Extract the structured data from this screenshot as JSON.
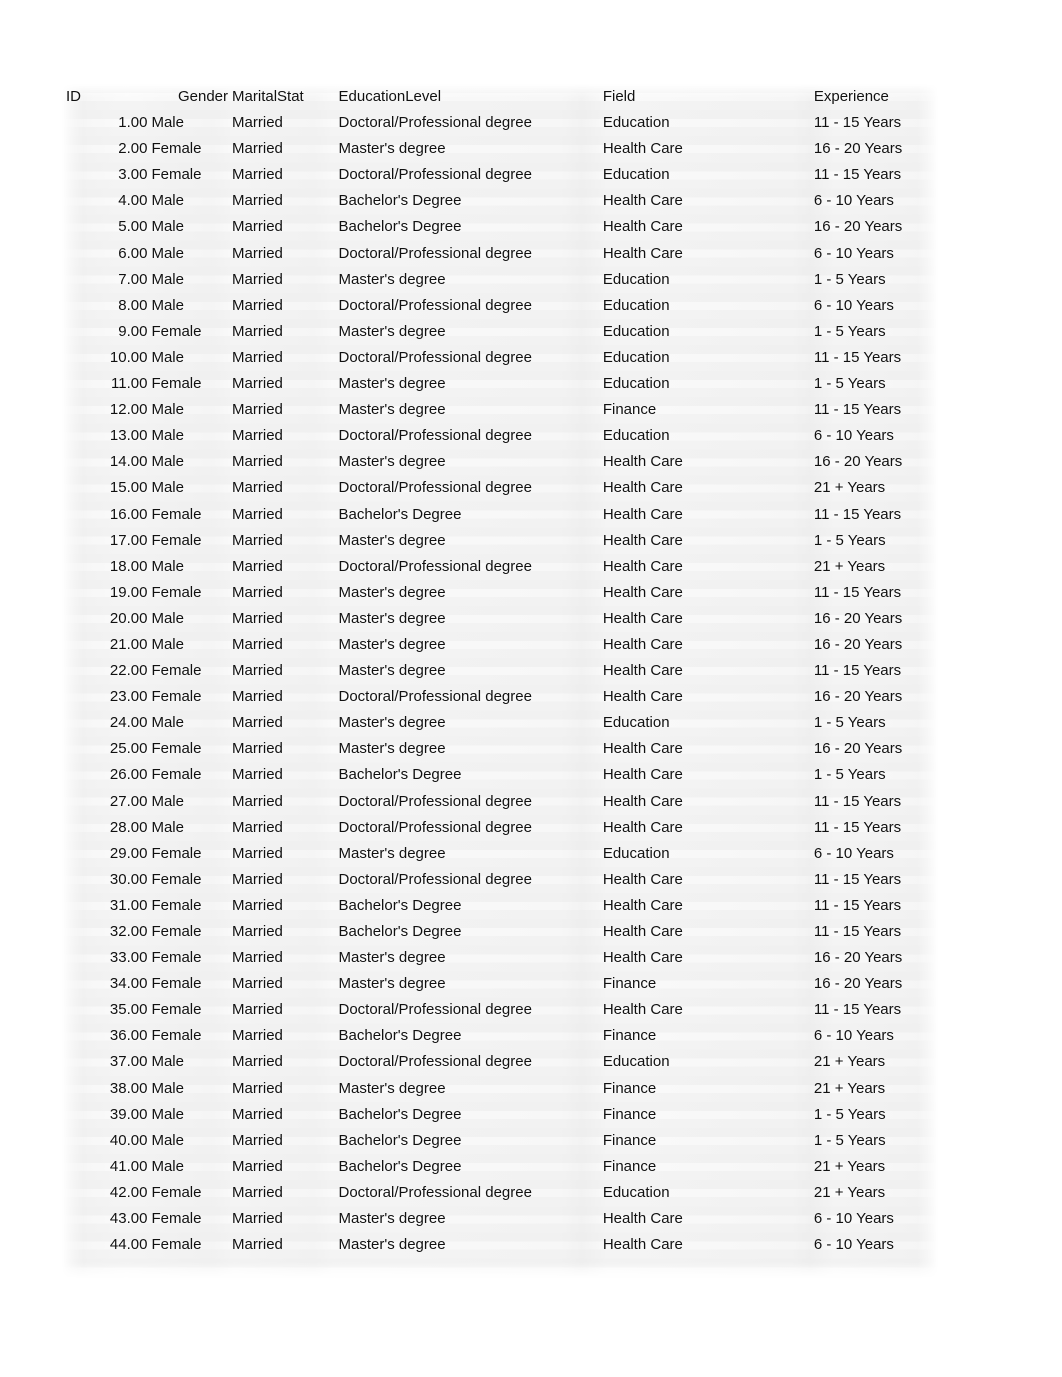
{
  "table": {
    "columns": [
      {
        "key": "id",
        "label": "ID",
        "align": "right"
      },
      {
        "key": "gender",
        "label": "Gender",
        "align": "left"
      },
      {
        "key": "marital",
        "label": "MaritalStat",
        "align": "left"
      },
      {
        "key": "edu",
        "label": "EducationLevel",
        "align": "left"
      },
      {
        "key": "field",
        "label": "Field",
        "align": "left"
      },
      {
        "key": "exp",
        "label": "Experience",
        "align": "left"
      }
    ],
    "row_count": 44,
    "rows": [
      [
        "1.00",
        "Male",
        "Married",
        "Doctoral/Professional degree",
        "Education",
        "11 - 15 Years"
      ],
      [
        "2.00",
        "Female",
        "Married",
        "Master's degree",
        "Health Care",
        "16 - 20 Years"
      ],
      [
        "3.00",
        "Female",
        "Married",
        "Doctoral/Professional degree",
        "Education",
        "11 - 15 Years"
      ],
      [
        "4.00",
        "Male",
        "Married",
        "Bachelor's Degree",
        "Health Care",
        "6 - 10 Years"
      ],
      [
        "5.00",
        "Male",
        "Married",
        "Bachelor's Degree",
        "Health Care",
        "16 - 20 Years"
      ],
      [
        "6.00",
        "Male",
        "Married",
        "Doctoral/Professional degree",
        "Health Care",
        "6 - 10 Years"
      ],
      [
        "7.00",
        "Male",
        "Married",
        "Master's degree",
        "Education",
        "1 - 5 Years"
      ],
      [
        "8.00",
        "Male",
        "Married",
        "Doctoral/Professional degree",
        "Education",
        "6 - 10 Years"
      ],
      [
        "9.00",
        "Female",
        "Married",
        "Master's degree",
        "Education",
        "1 - 5 Years"
      ],
      [
        "10.00",
        "Male",
        "Married",
        "Doctoral/Professional degree",
        "Education",
        "11 - 15 Years"
      ],
      [
        "11.00",
        "Female",
        "Married",
        "Master's degree",
        "Education",
        "1 - 5 Years"
      ],
      [
        "12.00",
        "Male",
        "Married",
        "Master's degree",
        "Finance",
        "11 - 15 Years"
      ],
      [
        "13.00",
        "Male",
        "Married",
        "Doctoral/Professional degree",
        "Education",
        "6 - 10 Years"
      ],
      [
        "14.00",
        "Male",
        "Married",
        "Master's degree",
        "Health Care",
        "16 - 20 Years"
      ],
      [
        "15.00",
        "Male",
        "Married",
        "Doctoral/Professional degree",
        "Health Care",
        "21 + Years"
      ],
      [
        "16.00",
        "Female",
        "Married",
        "Bachelor's Degree",
        "Health Care",
        "11 - 15 Years"
      ],
      [
        "17.00",
        "Female",
        "Married",
        "Master's degree",
        "Health Care",
        "1 - 5 Years"
      ],
      [
        "18.00",
        "Male",
        "Married",
        "Doctoral/Professional degree",
        "Health Care",
        "21 + Years"
      ],
      [
        "19.00",
        "Female",
        "Married",
        "Master's degree",
        "Health Care",
        "11 - 15 Years"
      ],
      [
        "20.00",
        "Male",
        "Married",
        "Master's degree",
        "Health Care",
        "16 - 20 Years"
      ],
      [
        "21.00",
        "Male",
        "Married",
        "Master's degree",
        "Health Care",
        "16 - 20 Years"
      ],
      [
        "22.00",
        "Female",
        "Married",
        "Master's degree",
        "Health Care",
        "11 - 15 Years"
      ],
      [
        "23.00",
        "Female",
        "Married",
        "Doctoral/Professional degree",
        "Health Care",
        "16 - 20 Years"
      ],
      [
        "24.00",
        "Male",
        "Married",
        "Master's degree",
        "Education",
        "1 - 5 Years"
      ],
      [
        "25.00",
        "Female",
        "Married",
        "Master's degree",
        "Health Care",
        "16 - 20 Years"
      ],
      [
        "26.00",
        "Female",
        "Married",
        "Bachelor's Degree",
        "Health Care",
        "1 - 5 Years"
      ],
      [
        "27.00",
        "Male",
        "Married",
        "Doctoral/Professional degree",
        "Health Care",
        "11 - 15 Years"
      ],
      [
        "28.00",
        "Male",
        "Married",
        "Doctoral/Professional degree",
        "Health Care",
        "11 - 15 Years"
      ],
      [
        "29.00",
        "Female",
        "Married",
        "Master's degree",
        "Education",
        "6 - 10 Years"
      ],
      [
        "30.00",
        "Female",
        "Married",
        "Doctoral/Professional degree",
        "Health Care",
        "11 - 15 Years"
      ],
      [
        "31.00",
        "Female",
        "Married",
        "Bachelor's Degree",
        "Health Care",
        "11 - 15 Years"
      ],
      [
        "32.00",
        "Female",
        "Married",
        "Bachelor's Degree",
        "Health Care",
        "11 - 15 Years"
      ],
      [
        "33.00",
        "Female",
        "Married",
        "Master's degree",
        "Health Care",
        "16 - 20 Years"
      ],
      [
        "34.00",
        "Female",
        "Married",
        "Master's degree",
        "Finance",
        "16 - 20 Years"
      ],
      [
        "35.00",
        "Female",
        "Married",
        "Doctoral/Professional degree",
        "Health Care",
        "11 - 15 Years"
      ],
      [
        "36.00",
        "Female",
        "Married",
        "Bachelor's Degree",
        "Finance",
        "6 - 10 Years"
      ],
      [
        "37.00",
        "Male",
        "Married",
        "Doctoral/Professional degree",
        "Education",
        "21 + Years"
      ],
      [
        "38.00",
        "Male",
        "Married",
        "Master's degree",
        "Finance",
        "21 + Years"
      ],
      [
        "39.00",
        "Male",
        "Married",
        "Bachelor's Degree",
        "Finance",
        "1 - 5 Years"
      ],
      [
        "40.00",
        "Male",
        "Married",
        "Bachelor's Degree",
        "Finance",
        "1 - 5 Years"
      ],
      [
        "41.00",
        "Male",
        "Married",
        "Bachelor's Degree",
        "Finance",
        "21 + Years"
      ],
      [
        "42.00",
        "Female",
        "Married",
        "Doctoral/Professional degree",
        "Education",
        "21 + Years"
      ],
      [
        "43.00",
        "Female",
        "Married",
        "Master's degree",
        "Health Care",
        "6 - 10 Years"
      ],
      [
        "44.00",
        "Female",
        "Married",
        "Master's degree",
        "Health Care",
        "6 - 10 Years"
      ]
    ]
  },
  "colors": {
    "page_background": "#ffffff",
    "plate_light": "#f2f2f2",
    "plate_stripe": "#fbfbfb",
    "text": "#111111"
  }
}
